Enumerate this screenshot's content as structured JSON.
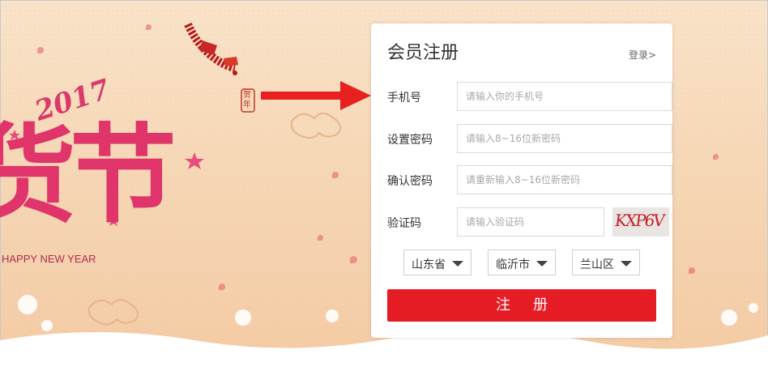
{
  "banner": {
    "year": "2017",
    "headline": "货节",
    "tagline": "HAPPY NEW YEAR",
    "seal": "贺年"
  },
  "form": {
    "title": "会员注册",
    "login_link": "登录>",
    "phone": {
      "label": "手机号",
      "placeholder": "请输入你的手机号"
    },
    "password": {
      "label": "设置密码",
      "placeholder": "请输入8~16位新密码"
    },
    "confirm": {
      "label": "确认密码",
      "placeholder": "请重新输入8~16位新密码"
    },
    "captcha": {
      "label": "验证码",
      "placeholder": "请输入验证码",
      "code": "KXP6V"
    },
    "region": {
      "province": "山东省",
      "city": "临沂市",
      "district": "兰山区"
    },
    "submit_label": "注册"
  },
  "colors": {
    "accent": "#e61c24",
    "headline": "#e0356a",
    "background": "#f6d7b6"
  }
}
